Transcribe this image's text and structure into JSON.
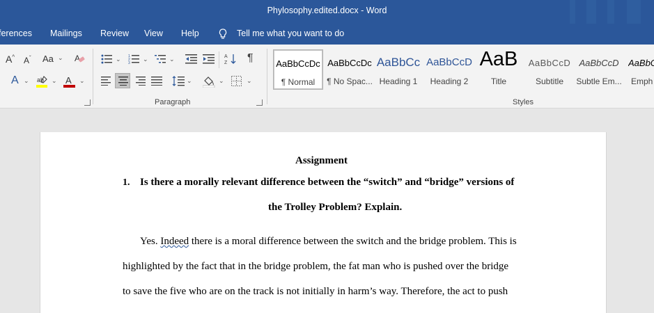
{
  "window": {
    "title": "Phylosophy.edited.docx  -  Word"
  },
  "menu": {
    "tabs": [
      "ferences",
      "Mailings",
      "Review",
      "View",
      "Help"
    ],
    "tell_me": "Tell me what you want to do"
  },
  "ribbon": {
    "font": {
      "case_label": "Aa"
    },
    "groups": {
      "paragraph": "Paragraph",
      "styles": "Styles"
    },
    "styles": [
      {
        "sample": "AaBbCcDc",
        "name": "¶ Normal",
        "color": "#000000",
        "selected": true
      },
      {
        "sample": "AaBbCcDc",
        "name": "¶ No Spac...",
        "color": "#000000"
      },
      {
        "sample": "AaBbCc",
        "name": "Heading 1",
        "color": "#2f5597"
      },
      {
        "sample": "AaBbCcD",
        "name": "Heading 2",
        "color": "#2f5597"
      },
      {
        "sample": "AaB",
        "name": "Title",
        "color": "#000000"
      },
      {
        "sample": "AaBbCcD",
        "name": "Subtitle",
        "color": "#595959"
      },
      {
        "sample": "AaBbCcD",
        "name": "Subtle Em...",
        "color": "#404040"
      },
      {
        "sample": "AaBbC",
        "name": "Emph",
        "color": "#000000"
      }
    ]
  },
  "document": {
    "heading": "Assignment",
    "question_number": "1.",
    "question_line1": "Is there a morally relevant difference between the “switch” and “bridge” versions of",
    "question_line2": "the Trolley Problem? Explain.",
    "para_word1": "Yes.",
    "para_word2": "Indeed",
    "para_line1_rest": "there is a moral difference between the switch and the bridge problem. This is",
    "para_line2": "highlighted by the fact that in the bridge problem, the fat man who is pushed over the bridge",
    "para_line3": "to save the five who are on the track is not initially in harm’s way. Therefore, the act to push"
  },
  "colors": {
    "title_bar": "#2b579a",
    "ribbon": "#f3f3f3",
    "canvas": "#e6e6e6",
    "font_color_bar": "#c00000",
    "highlight_bar": "#ffff00"
  }
}
